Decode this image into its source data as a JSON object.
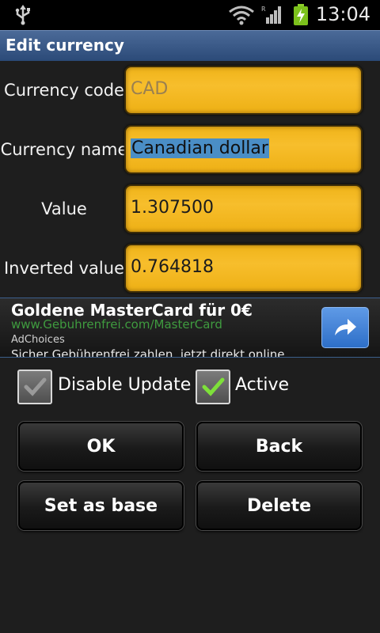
{
  "status_bar": {
    "time": "13:04",
    "icons": [
      "usb-icon",
      "wifi-icon",
      "signal-icon",
      "battery-charging-icon"
    ]
  },
  "title": "Edit currency",
  "form": {
    "code_label": "Currency code",
    "code_value": "CAD",
    "name_label": "Currency name",
    "name_value": "Canadian dollar",
    "value_label": "Value",
    "value_value": "1.307500",
    "inverted_label": "Inverted value",
    "inverted_value": "0.764818"
  },
  "ad": {
    "headline": "Goldene MasterCard für 0€",
    "url": "www.Gebuhrenfrei.com/MasterCard",
    "adchoices": "AdChoices",
    "description": "Sicher Gebührenfrei zahlen, jetzt direkt online",
    "icon": "share-arrow-icon"
  },
  "checkboxes": {
    "disable_update_label": "Disable Update",
    "disable_update_checked": false,
    "active_label": "Active",
    "active_checked": true
  },
  "buttons": {
    "ok": "OK",
    "back": "Back",
    "set_as_base": "Set as base",
    "delete": "Delete"
  },
  "colors": {
    "field": "#f7be2c",
    "title_bar": "#3b5a88",
    "selection": "#4a8ec6",
    "check_green": "#7ee03a"
  }
}
